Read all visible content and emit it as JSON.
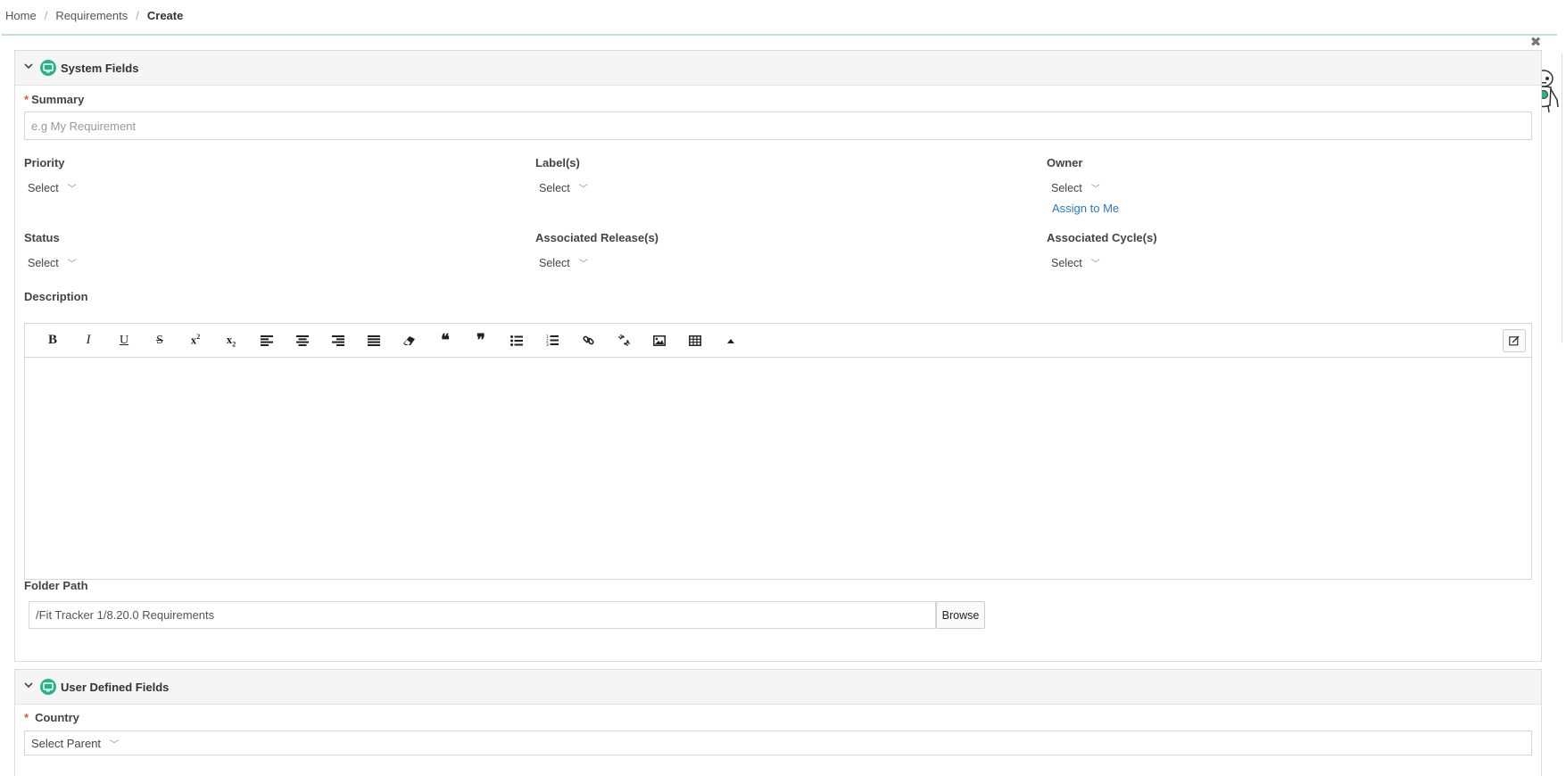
{
  "breadcrumb": {
    "home": "Home",
    "requirements": "Requirements",
    "current": "Create"
  },
  "system_fields": {
    "title": "System Fields",
    "summary": {
      "label": "Summary",
      "placeholder": "e.g My Requirement"
    },
    "priority": {
      "label": "Priority",
      "value": "Select"
    },
    "labels": {
      "label": "Label(s)",
      "value": "Select"
    },
    "owner": {
      "label": "Owner",
      "value": "Select",
      "assign_link": "Assign to Me"
    },
    "status": {
      "label": "Status",
      "value": "Select"
    },
    "associated_releases": {
      "label": "Associated Release(s)",
      "value": "Select"
    },
    "associated_cycles": {
      "label": "Associated Cycle(s)",
      "value": "Select"
    },
    "description": {
      "label": "Description",
      "toolbar": [
        "bold",
        "italic",
        "underline",
        "strikethrough",
        "superscript",
        "subscript",
        "align-left",
        "align-center",
        "align-right",
        "align-justify",
        "clear-format",
        "blockquote-open",
        "blockquote-close",
        "bullet-list",
        "numbered-list",
        "link",
        "unlink",
        "image",
        "table",
        "collapse"
      ]
    },
    "folder_path": {
      "label": "Folder Path",
      "value": "/Fit Tracker 1/8.20.0 Requirements",
      "browse_label": "Browse"
    }
  },
  "user_defined_fields": {
    "title": "User Defined Fields",
    "country": {
      "label": "Country",
      "value": "Select Parent"
    }
  },
  "colors": {
    "accent_green": "#2bb387",
    "link_blue": "#2a7ab8",
    "required_red": "#d9534f"
  }
}
